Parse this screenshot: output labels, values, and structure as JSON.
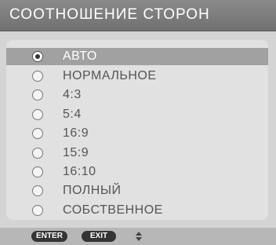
{
  "menu": {
    "title": "СООТНОШЕНИЕ СТОРОН",
    "options": [
      {
        "label": "АВТО",
        "selected": true
      },
      {
        "label": "НОРМАЛЬНОЕ",
        "selected": false
      },
      {
        "label": "4:3",
        "selected": false
      },
      {
        "label": "5:4",
        "selected": false
      },
      {
        "label": "16:9",
        "selected": false
      },
      {
        "label": "15:9",
        "selected": false
      },
      {
        "label": "16:10",
        "selected": false
      },
      {
        "label": "ПОЛНЫЙ",
        "selected": false
      },
      {
        "label": "СОБСТВЕННОЕ",
        "selected": false
      }
    ]
  },
  "footer": {
    "enter_label": "ENTER",
    "exit_label": "EXIT",
    "updown_icon": "up-down-arrows-icon"
  },
  "colors": {
    "title_bar": "#707070",
    "selection_bar": "#a1a1a1",
    "panel": "#e1e1e1",
    "background": "#d4d4d4"
  }
}
